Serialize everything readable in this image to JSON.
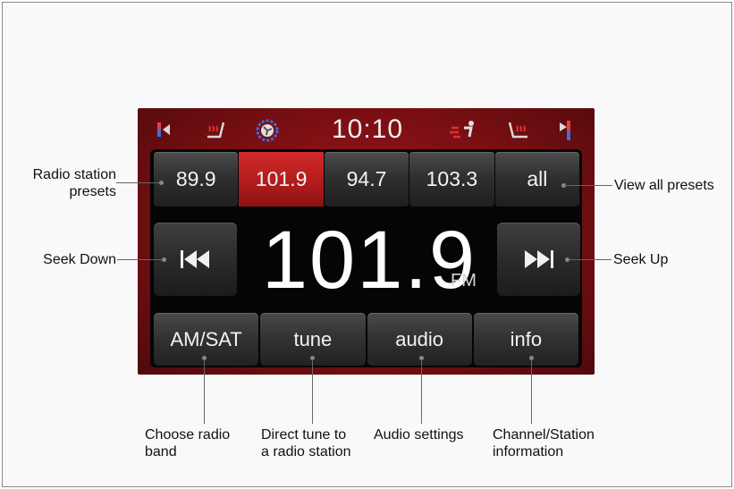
{
  "topbar": {
    "clock": "10:10",
    "icons": [
      "left-arrow-icon",
      "heated-seat-left-icon",
      "fan-icon",
      "airflow-icon",
      "heated-seat-right-icon",
      "right-arrow-icon"
    ]
  },
  "presets": [
    "89.9",
    "101.9",
    "94.7",
    "103.3",
    "all"
  ],
  "active_preset_index": 1,
  "frequency": "101.9",
  "band": "FM",
  "bottom_buttons": [
    "AM/SAT",
    "tune",
    "audio",
    "info"
  ],
  "callouts": {
    "presets": "Radio station\npresets",
    "view_all": "View all presets",
    "seek_down": "Seek Down",
    "seek_up": "Seek Up",
    "band": "Choose radio\nband",
    "tune": "Direct tune to\na radio station",
    "audio": "Audio settings",
    "info": "Channel/Station\ninformation"
  },
  "colors": {
    "accent_red": "#b01b1b",
    "screen_frame": "#8f1216",
    "control_gray": "#333333"
  }
}
